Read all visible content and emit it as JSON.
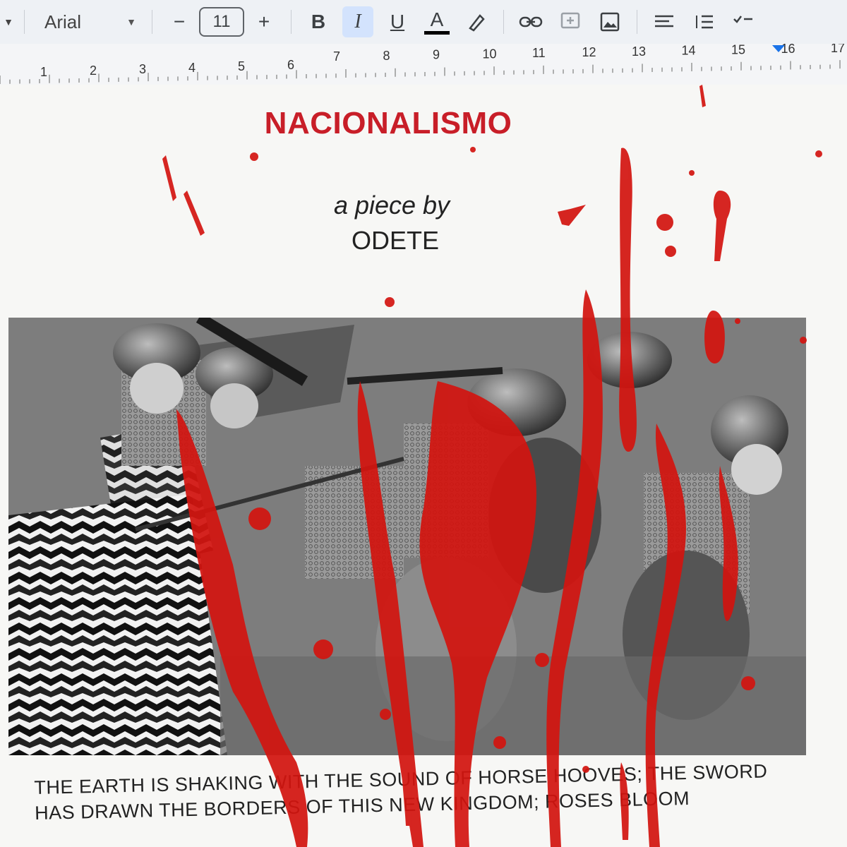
{
  "toolbar": {
    "font_name": "Arial",
    "font_size": "11",
    "decrease_size": "−",
    "increase_size": "+",
    "bold_label": "B",
    "italic_label": "I",
    "underline_label": "U",
    "text_color_label": "A",
    "icons": [
      "chevron-down-icon",
      "pen-icon",
      "link-icon",
      "comment-icon",
      "image-icon",
      "align-icon",
      "line-spacing-icon",
      "checklist-icon"
    ]
  },
  "ruler": {
    "top_marks": [
      "7",
      "8",
      "9",
      "10",
      "11",
      "12",
      "13",
      "14",
      "15",
      "16",
      "17"
    ],
    "bottom_marks": [
      "1",
      "2",
      "3",
      "4",
      "5",
      "6"
    ]
  },
  "document": {
    "title": "NACIONALISMO",
    "byline": "a piece by",
    "author": "ODETE",
    "image_description_icon": "medieval-battle-image",
    "body_lines": [
      "THE EARTH IS SHAKING WITH THE SOUND OF HORSE HOOVES; THE SWORD",
      "HAS DRAWN THE BORDERS OF THIS NEW KINGDOM; ROSES BLOOM"
    ]
  },
  "colors": {
    "title": "#c81e28",
    "blood": "#d3140f",
    "toolbar_bg": "#eef1f5",
    "active_button": "#d3e3fd"
  }
}
